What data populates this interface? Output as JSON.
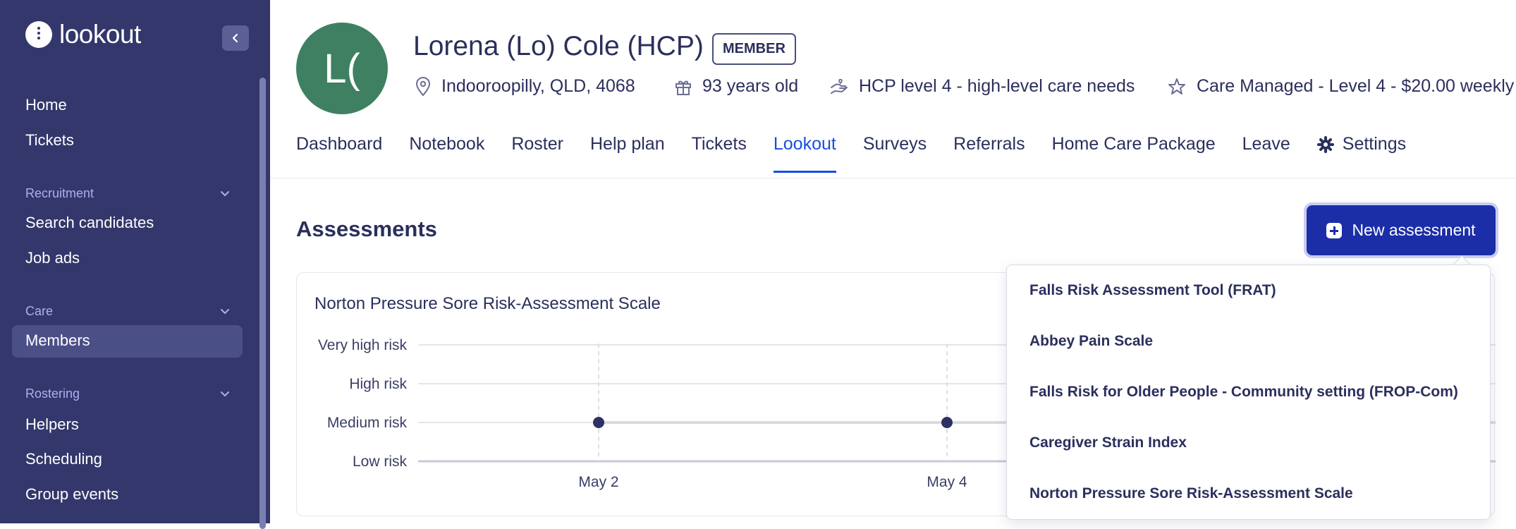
{
  "app": {
    "logo_text": "lookout"
  },
  "sidebar": {
    "items": [
      {
        "label": "Home"
      },
      {
        "label": "Tickets"
      }
    ],
    "sections": [
      {
        "title": "Recruitment",
        "items": [
          "Search candidates",
          "Job ads"
        ]
      },
      {
        "title": "Care",
        "items": [
          "Members"
        ]
      },
      {
        "title": "Rostering",
        "items": [
          "Helpers",
          "Scheduling",
          "Group events"
        ]
      }
    ],
    "active_item": "Members"
  },
  "profile": {
    "avatar_initials": "L(",
    "name": "Lorena (Lo) Cole (HCP)",
    "badge": "MEMBER",
    "location": "Indooroopilly, QLD, 4068",
    "age": "93 years old",
    "care_level": "HCP level 4 - high-level care needs",
    "package": "Care Managed - Level 4 - $20.00 weekly"
  },
  "tabs": [
    {
      "label": "Dashboard"
    },
    {
      "label": "Notebook"
    },
    {
      "label": "Roster"
    },
    {
      "label": "Help plan"
    },
    {
      "label": "Tickets"
    },
    {
      "label": "Lookout",
      "active": true
    },
    {
      "label": "Surveys"
    },
    {
      "label": "Referrals"
    },
    {
      "label": "Home Care Package"
    },
    {
      "label": "Leave"
    },
    {
      "label": "Settings",
      "icon": "gear-icon"
    }
  ],
  "assessments": {
    "title": "Assessments",
    "new_button": "New assessment",
    "menu": [
      "Falls Risk Assessment Tool (FRAT)",
      "Abbey Pain Scale",
      "Falls Risk for Older People - Community setting (FROP-Com)",
      "Caregiver Strain Index",
      "Norton Pressure Sore Risk-Assessment Scale"
    ]
  },
  "chart_data": {
    "type": "line",
    "title": "Norton Pressure Sore Risk-Assessment Scale",
    "y_categories": [
      "Low risk",
      "Medium risk",
      "High risk",
      "Very high risk"
    ],
    "x_ticks": [
      "May 2",
      "May 4"
    ],
    "series": [
      {
        "points": [
          {
            "x": "May 2",
            "y": "Medium risk"
          },
          {
            "x": "May 4",
            "y": "Medium risk"
          }
        ]
      }
    ],
    "grid": true
  },
  "colors": {
    "sidebar": "#33376b",
    "accent": "#1a4de0",
    "button": "#1b2ea8",
    "avatar": "#3f8063"
  }
}
